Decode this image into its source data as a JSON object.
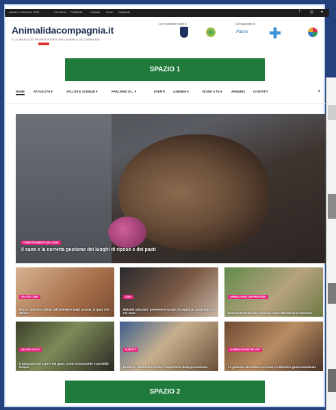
{
  "topbar": {
    "date": "sabato 5 settembre 2020",
    "links": [
      "Chi siamo",
      "Pubblicità",
      "Contatti",
      "Autori",
      "Registrati"
    ]
  },
  "header": {
    "logo": "Animalidacompagnia.it",
    "tagline": "IL GIORNALE DEI PROFESSIONISTI DELL'ANIMALE DA COMPAGNIA",
    "sponsor_label_1": "Con il patrocinio morale di",
    "sponsor_label_2": "Con il patrocinio di",
    "sponsor_logo_text": "Patrox"
  },
  "ads": {
    "top": "SPAZIO 1",
    "bottom": "SPAZIO 2"
  },
  "nav": {
    "items": [
      "HOME",
      "ATTUALITÀ ▾",
      "SALUTE E SCIENZE ▾",
      "PARLIAMO DI... ▾",
      "EVENTI",
      "AZIENDE ▾",
      "VICINO A TE ▾",
      "ANNUNCI",
      "CONTATTI"
    ]
  },
  "hero": {
    "badge": "COMPORTAMENTO DEL CANE",
    "title": "Il cane e la corretta gestione dei luoghi di riposo e dei pasti"
  },
  "cards": [
    {
      "badge": "SALUTE CANE",
      "title": "Bocca, intestino alleati nell'animale e negli animali, ai quali si è attivo?"
    },
    {
      "badge": "CANI",
      "title": "Malattie articolari: prevenire e curare. Prospettive cardiologiche nel cane"
    },
    {
      "badge": "ANIMALI NON CONVENZIONALI",
      "title": "Gastrointestinale del coniglio: come affrontarla e risolverla"
    },
    {
      "badge": "SALUTE GATTO",
      "title": "Il glaucoma nel cane e nel gatto: come riconoscerlo e possibili terapie"
    },
    {
      "badge": "FURETTO",
      "title": "Problemi dentali del furetto: l'importanza della prevenzione"
    },
    {
      "badge": "ALIMENTAZIONE DEL PET",
      "title": "La gestione alimentare nel cane e il disturbo gastrointestinale"
    }
  ]
}
